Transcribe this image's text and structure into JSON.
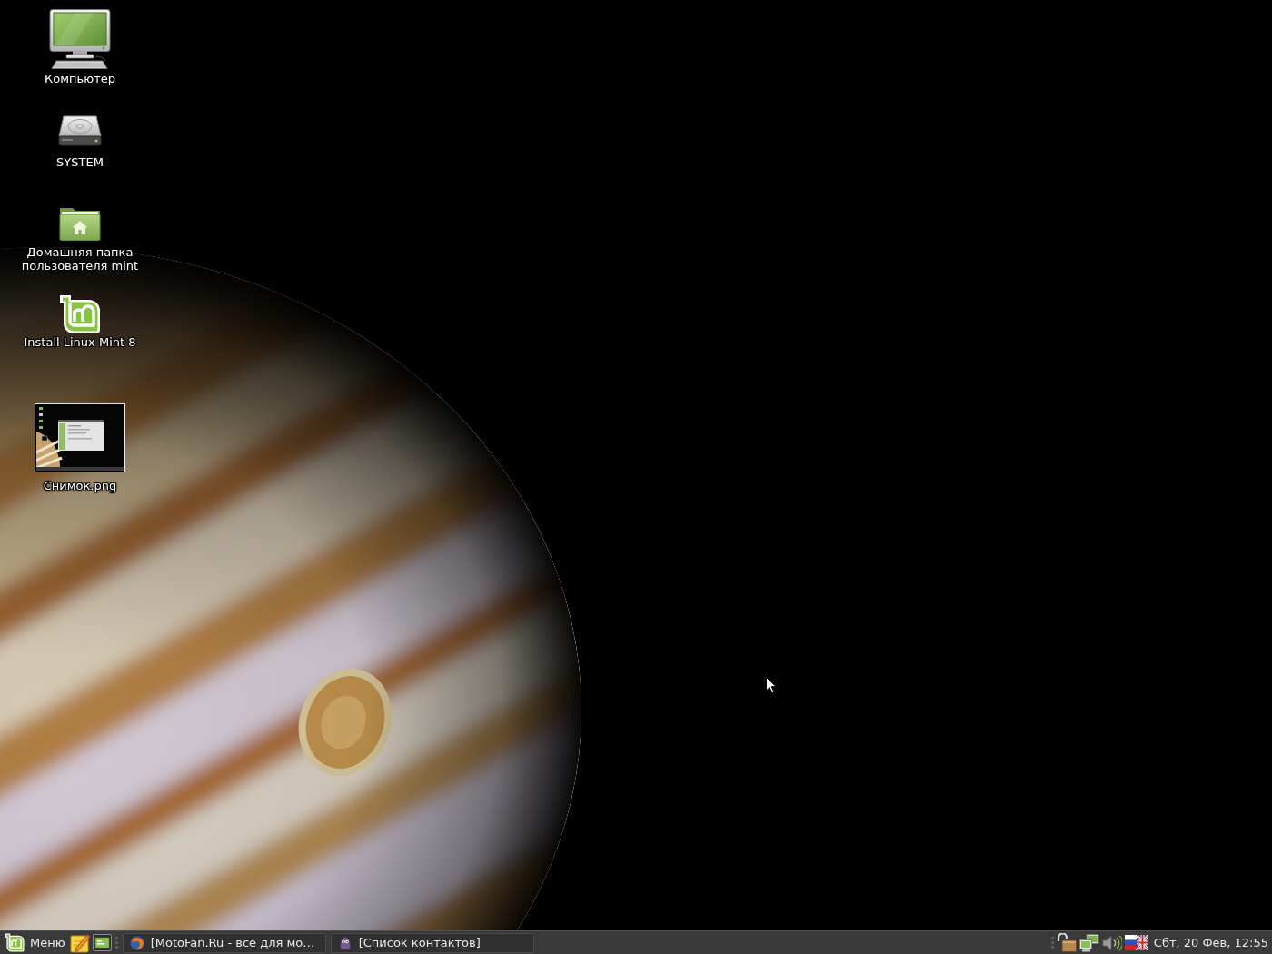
{
  "desktop": {
    "icons": [
      {
        "kind": "computer",
        "label": "Компьютер"
      },
      {
        "kind": "drive",
        "label": "SYSTEM"
      },
      {
        "kind": "home-folder",
        "label": "Домашняя папка пользователя mint"
      },
      {
        "kind": "installer",
        "label": "Install Linux Mint 8"
      },
      {
        "kind": "image",
        "label": "Снимок.png"
      }
    ]
  },
  "taskbar": {
    "menu_button": {
      "label": "Меню"
    },
    "window_buttons": [
      {
        "kind": "browser",
        "title": "[MotoFan.Ru - все для мо…",
        "selected": false
      },
      {
        "kind": "messenger",
        "title": "[Список контактов]",
        "selected": false
      }
    ],
    "clock": "Сбт, 20 Фев, 12:55"
  }
}
